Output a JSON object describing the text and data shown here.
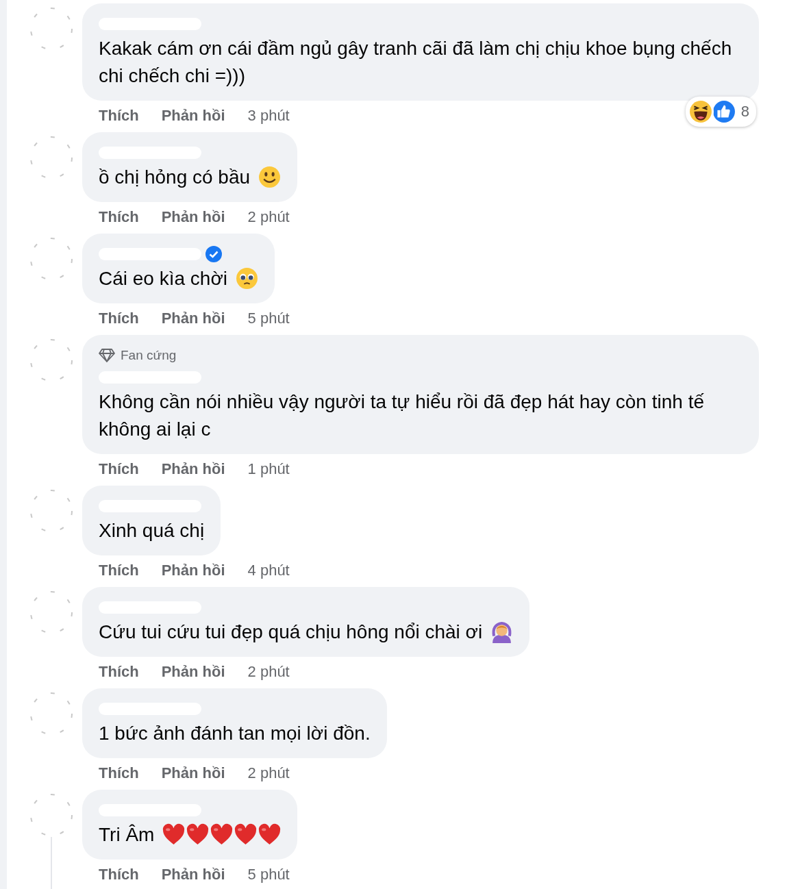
{
  "comments": [
    {
      "verified": false,
      "text": "Kakak cám ơn cái đầm ngủ gây tranh cãi đã làm chị chịu khoe bụng chếch chi chếch chi =)))",
      "like": "Thích",
      "reply": "Phản hồi",
      "time": "3 phút",
      "reactions": {
        "icons": [
          {
            "kind": "haha"
          },
          {
            "kind": "like"
          }
        ],
        "count": "8"
      }
    },
    {
      "verified": false,
      "text": "ồ chị hỏng có bầu",
      "trailing_icons": [
        {
          "kind": "smiley"
        }
      ],
      "like": "Thích",
      "reply": "Phản hồi",
      "time": "2 phút"
    },
    {
      "verified": true,
      "text": "Cái eo kìa chời",
      "trailing_icons": [
        {
          "kind": "pleading"
        }
      ],
      "like": "Thích",
      "reply": "Phản hồi",
      "time": "5 phút"
    },
    {
      "badge": "Fan cứng",
      "verified": false,
      "text": "Không cần nói nhiều vậy người ta tự hiểu rồi đã đẹp hát hay còn tinh tế không ai lại c",
      "like": "Thích",
      "reply": "Phản hồi",
      "time": "1 phút"
    },
    {
      "verified": false,
      "text": "Xinh quá chị",
      "like": "Thích",
      "reply": "Phản hồi",
      "time": "4 phút"
    },
    {
      "verified": false,
      "text": "Cứu tui cứu tui đẹp quá chịu hông nổi chài ơi",
      "trailing_icons": [
        {
          "kind": "gesture"
        }
      ],
      "like": "Thích",
      "reply": "Phản hồi",
      "time": "2 phút"
    },
    {
      "verified": false,
      "text": "1 bức ảnh đánh tan mọi lời đồn.",
      "like": "Thích",
      "reply": "Phản hồi",
      "time": "2 phút"
    },
    {
      "verified": false,
      "text": "Tri Âm",
      "trailing_icons": [
        {
          "kind": "heart"
        },
        {
          "kind": "heart"
        },
        {
          "kind": "heart"
        },
        {
          "kind": "heart"
        },
        {
          "kind": "heart"
        }
      ],
      "like": "Thích",
      "reply": "Phản hồi",
      "time": "5 phút"
    }
  ]
}
